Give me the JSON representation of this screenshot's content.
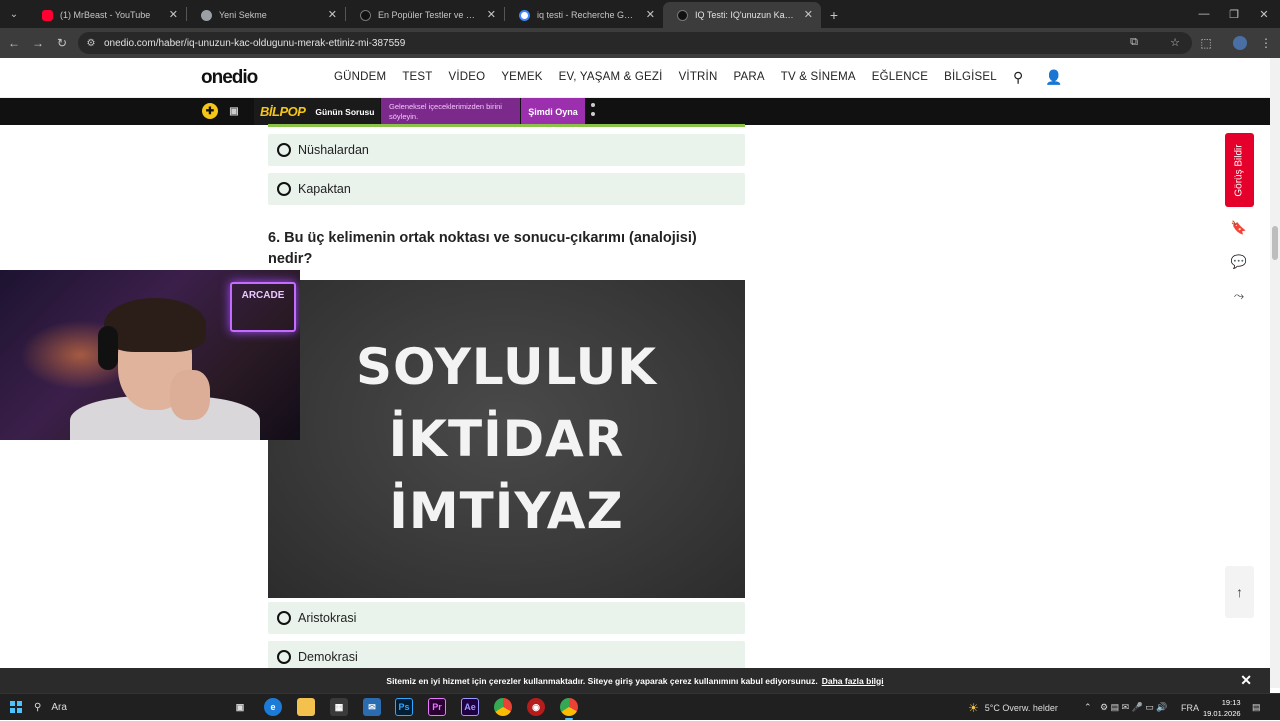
{
  "browser": {
    "tabs": [
      {
        "title": "(1) MrBeast - YouTube",
        "color": "#ff0033",
        "active": false
      },
      {
        "title": "Yeni Sekme",
        "color": "#9aa0a6",
        "active": false
      },
      {
        "title": "En Popüler Testler ve Eğlenceli",
        "color": "#222222",
        "active": false
      },
      {
        "title": "iq testi - Recherche Google",
        "color": "#4285f4",
        "active": false
      },
      {
        "title": "IQ Testi: IQ'unuzun Kaç Olduğu",
        "color": "#222222",
        "active": true
      }
    ],
    "url": "onedio.com/haber/iq-unuzun-kac-oldugunu-merak-ettiniz-mi-387559"
  },
  "site": {
    "logo": "onedio",
    "nav": [
      "GÜNDEM",
      "TEST",
      "VİDEO",
      "YEMEK",
      "EV, YAŞAM & GEZİ",
      "VİTRİN",
      "PARA",
      "TV & SİNEMA",
      "EĞLENCE",
      "BİLGİSEL"
    ],
    "promo": {
      "brand": "BİLPOP",
      "label": "Günün Sorusu",
      "text": "Geleneksel içeceklerimizden birini söyleyin.",
      "button": "Şimdi Oyna"
    }
  },
  "quiz": {
    "prev_options": [
      "Nüshalardan",
      "Kapaktan"
    ],
    "question": "6. Bu üç kelimenin ortak noktası ve sonucu-çıkarımı (analojisi) nedir?",
    "image_words": [
      "SOYLULUK",
      "İKTİDAR",
      "İMTİYAZ"
    ],
    "options": [
      "Aristokrasi",
      "Demokrasi"
    ]
  },
  "sidebar": {
    "feedback": "Görüş Bildir"
  },
  "webcam": {
    "sign": "ARCADE"
  },
  "cookie": {
    "text": "Sitemiz en iyi hizmet için çerezler kullanmaktadır. Siteye giriş yaparak çerez kullanımını kabul ediyorsunuz.",
    "link": "Daha fazla bilgi"
  },
  "taskbar": {
    "search": "Ara",
    "weather": "5°C  Overw. helder",
    "lang": "FRA",
    "time": "19:13",
    "date": "19.01.2026"
  }
}
